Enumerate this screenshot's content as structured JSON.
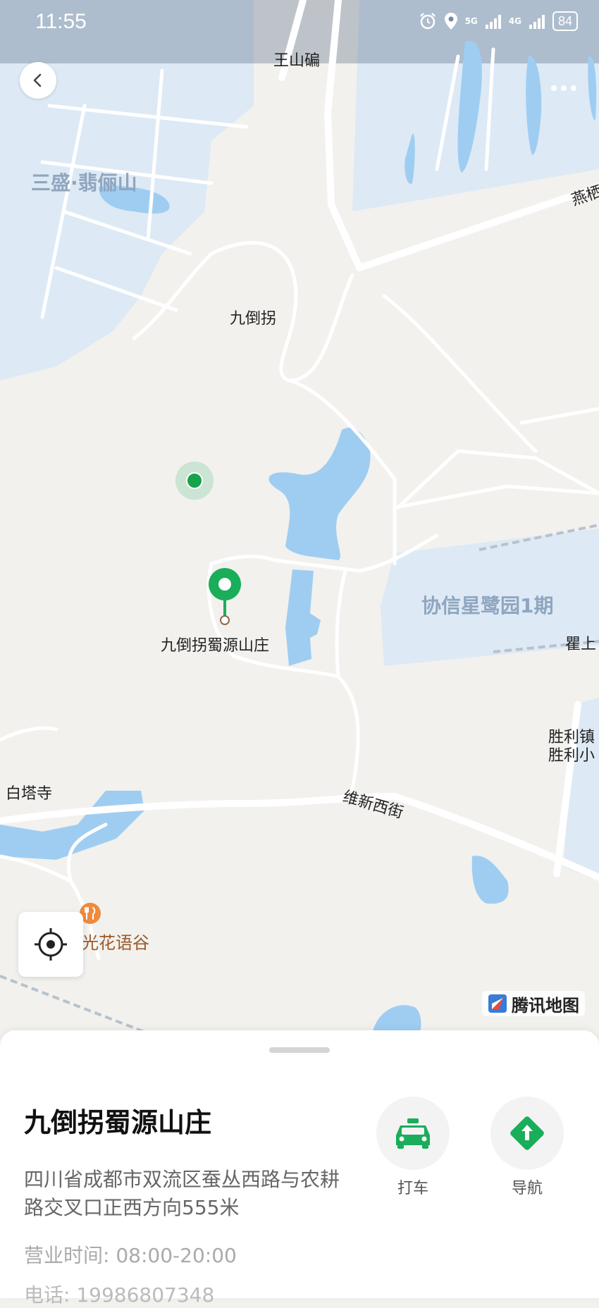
{
  "status_bar": {
    "time": "11:55",
    "signal_5g": "5G",
    "signal_4g": "4G",
    "battery": "84"
  },
  "nav": {
    "back_icon": "chevron-left-icon",
    "more_icon": "more-dots-icon"
  },
  "map": {
    "labels": {
      "wangshanbei": "王山碥",
      "sansheng": "三盛·翡俪山",
      "yan": "燕栖",
      "jiudaoguai": "九倒拐",
      "xiexin": "协信星鹭园1期",
      "qushang": "瞿上",
      "shengli_town": "胜利镇",
      "shengli_school": "胜利小",
      "baitasi": "白塔寺",
      "weixin_street": "维新西街",
      "guanghuayu": "光花语谷",
      "poi_name": "九倒拐蜀源山庄"
    },
    "brand": "腾讯地图",
    "colors": {
      "water": "#9fcdf2",
      "land": "#f2f1ee",
      "residential": "#dde9f5",
      "pin": "#1aad5a"
    }
  },
  "sheet": {
    "title": "九倒拐蜀源山庄",
    "address": "四川省成都市双流区蚕丛西路与农耕路交叉口正西方向555米",
    "hours": "营业时间: 08:00-20:00",
    "phone": "电话: 19986807348",
    "actions": {
      "taxi": "打车",
      "navigate": "导航"
    }
  }
}
